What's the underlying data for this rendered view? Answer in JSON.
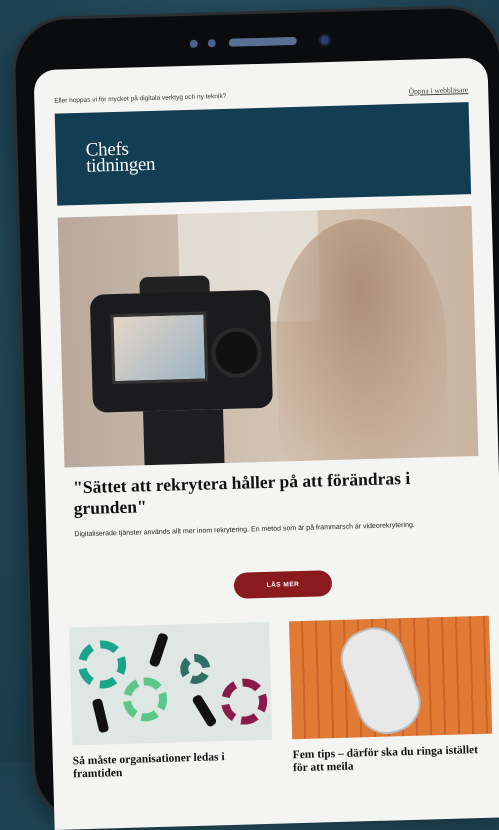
{
  "email": {
    "preheader": "Eller hoppas vi för mycket på digitala verktyg och ny teknik?",
    "open_in_browser": "Öppna i webbläsare",
    "logo_line1": "Chefs",
    "logo_line2": "tidningen",
    "headline": "\"Sättet att rekrytera håller på att förändras i grunden\"",
    "lead": "Digitaliserade tjänster används allt mer inom rekrytering. En metod som är på frammarsch är videorekrytering.",
    "cta_label": "LÄS MER",
    "cards": [
      {
        "title": "Så måste organisationer ledas i framtiden"
      },
      {
        "title": "Fem tips – därför ska du ringa istället för att meila"
      }
    ]
  },
  "colors": {
    "background": "#234a5b",
    "header": "#123d52",
    "cta": "#8b1a1f"
  }
}
